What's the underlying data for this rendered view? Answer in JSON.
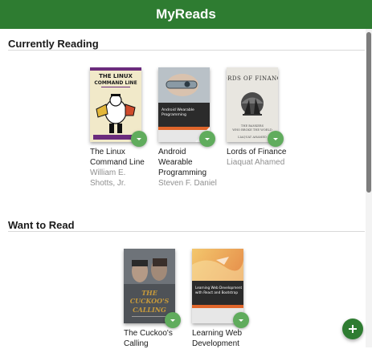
{
  "app": {
    "title": "MyReads",
    "accent_color": "#2e7c31",
    "changer_color": "#60ac5d"
  },
  "shelves": [
    {
      "title": "Currently Reading",
      "books": [
        {
          "title": "The Linux Command Line",
          "authors": "William E. Shotts, Jr.",
          "cover": {
            "top_text": "THE LINUX COMMAND LINE",
            "bg": "#f1e9c9",
            "band": "#6b2c7d"
          }
        },
        {
          "title": "Android Wearable Programming",
          "authors": "Steven F. Daniel",
          "cover": {
            "text": "Android Wearable Programming",
            "bg": "#cfd4d8",
            "band": "#2b2b2b",
            "accent": "#e0662b"
          }
        },
        {
          "title": "Lords of Finance",
          "authors": "Liaquat Ahamed",
          "cover": {
            "text": "LORDS OF FINANCE",
            "bg": "#e8e6e0"
          }
        }
      ]
    },
    {
      "title": "Want to Read",
      "books": [
        {
          "title": "The Cuckoo's Calling",
          "authors": "",
          "cover": {
            "text": "THE CUCKOO'S CALLING",
            "bg": "#4e5257",
            "accent": "#c79a3b"
          }
        },
        {
          "title": "Learning Web Development",
          "authors": "",
          "cover": {
            "text": "Learning Web Development with React and Bootstrap",
            "bg": "#e99a3a",
            "band": "#2b2b2b"
          }
        }
      ]
    }
  ],
  "icons": {
    "shelf_changer": "chevron-down-icon",
    "add": "plus-icon"
  }
}
